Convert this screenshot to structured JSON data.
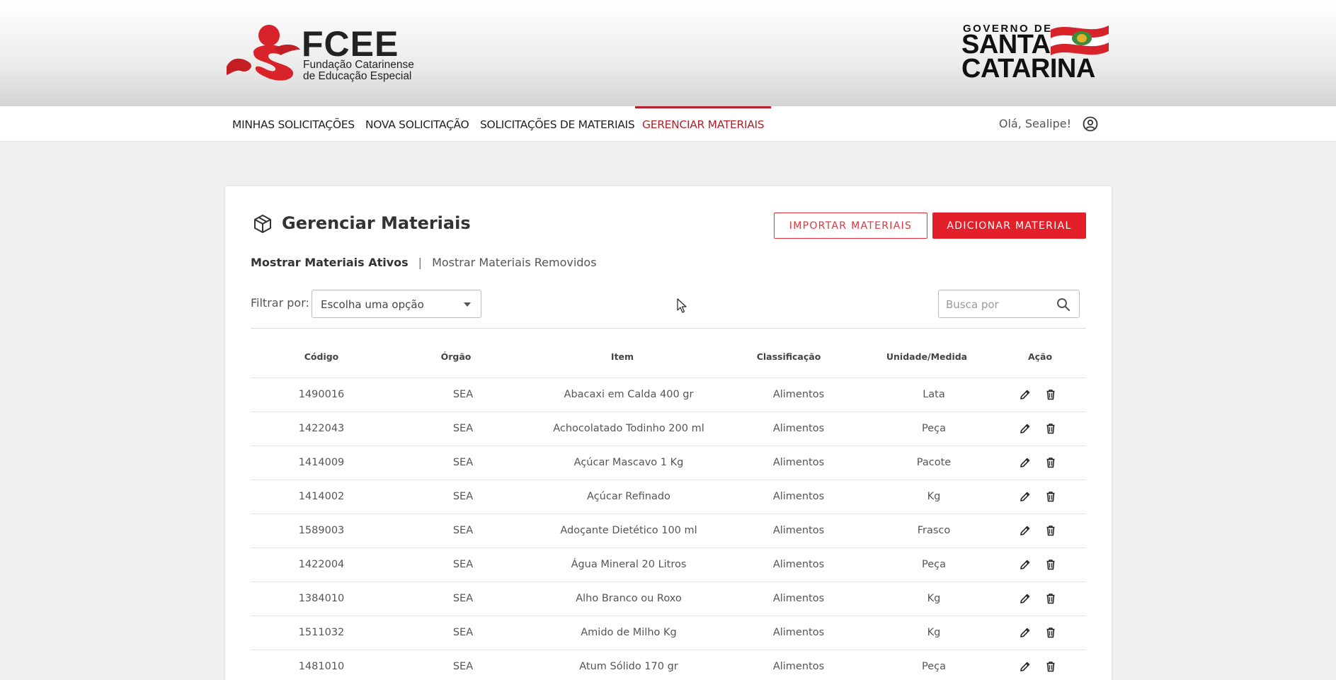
{
  "header": {
    "fcee_title": "FCEE",
    "fcee_sub_1": "Fundação Catarinense",
    "fcee_sub_2": "de Educação Especial",
    "gov_line": "GOVERNO DE",
    "gov_santa": "SANTA",
    "gov_catarina": "CATARINA"
  },
  "nav": {
    "items": [
      {
        "label": "MINHAS SOLICITAÇÕES"
      },
      {
        "label": "NOVA SOLICITAÇÃO"
      },
      {
        "label": "SOLICITAÇÕES DE MATERIAIS"
      },
      {
        "label": "GERENCIAR MATERIAIS",
        "active": true
      }
    ],
    "greeting": "Olá, Sealipe!"
  },
  "page": {
    "title": "Gerenciar Materiais",
    "import_button": "IMPORTAR MATERIAIS",
    "add_button": "ADICIONAR MATERIAL",
    "toggle_active": "Mostrar Materiais Ativos",
    "toggle_separator": "|",
    "toggle_removed": "Mostrar Materiais Removidos",
    "filter_label": "Filtrar por:",
    "filter_value": "Escolha uma opção",
    "search_placeholder": "Busca por"
  },
  "table": {
    "headers": {
      "codigo": "Código",
      "orgao": "Órgão",
      "item": "Item",
      "classificacao": "Classificação",
      "unidade": "Unidade/Medida",
      "acao": "Ação"
    },
    "rows": [
      {
        "codigo": "1490016",
        "orgao": "SEA",
        "item": "Abacaxi em Calda 400 gr",
        "classificacao": "Alimentos",
        "unidade": "Lata"
      },
      {
        "codigo": "1422043",
        "orgao": "SEA",
        "item": "Achocolatado Todinho 200 ml",
        "classificacao": "Alimentos",
        "unidade": "Peça"
      },
      {
        "codigo": "1414009",
        "orgao": "SEA",
        "item": "Açúcar Mascavo 1 Kg",
        "classificacao": "Alimentos",
        "unidade": "Pacote"
      },
      {
        "codigo": "1414002",
        "orgao": "SEA",
        "item": "Açúcar Refinado",
        "classificacao": "Alimentos",
        "unidade": "Kg"
      },
      {
        "codigo": "1589003",
        "orgao": "SEA",
        "item": "Adoçante Dietético 100 ml",
        "classificacao": "Alimentos",
        "unidade": "Frasco"
      },
      {
        "codigo": "1422004",
        "orgao": "SEA",
        "item": "Água Mineral 20 Litros",
        "classificacao": "Alimentos",
        "unidade": "Peça"
      },
      {
        "codigo": "1384010",
        "orgao": "SEA",
        "item": "Alho Branco ou Roxo",
        "classificacao": "Alimentos",
        "unidade": "Kg"
      },
      {
        "codigo": "1511032",
        "orgao": "SEA",
        "item": "Amido de Milho Kg",
        "classificacao": "Alimentos",
        "unidade": "Kg"
      },
      {
        "codigo": "1481010",
        "orgao": "SEA",
        "item": "Atum Sólido 170 gr",
        "classificacao": "Alimentos",
        "unidade": "Peça"
      }
    ]
  },
  "colors": {
    "brand_red": "#e3202a",
    "active_nav": "#b5202a"
  }
}
